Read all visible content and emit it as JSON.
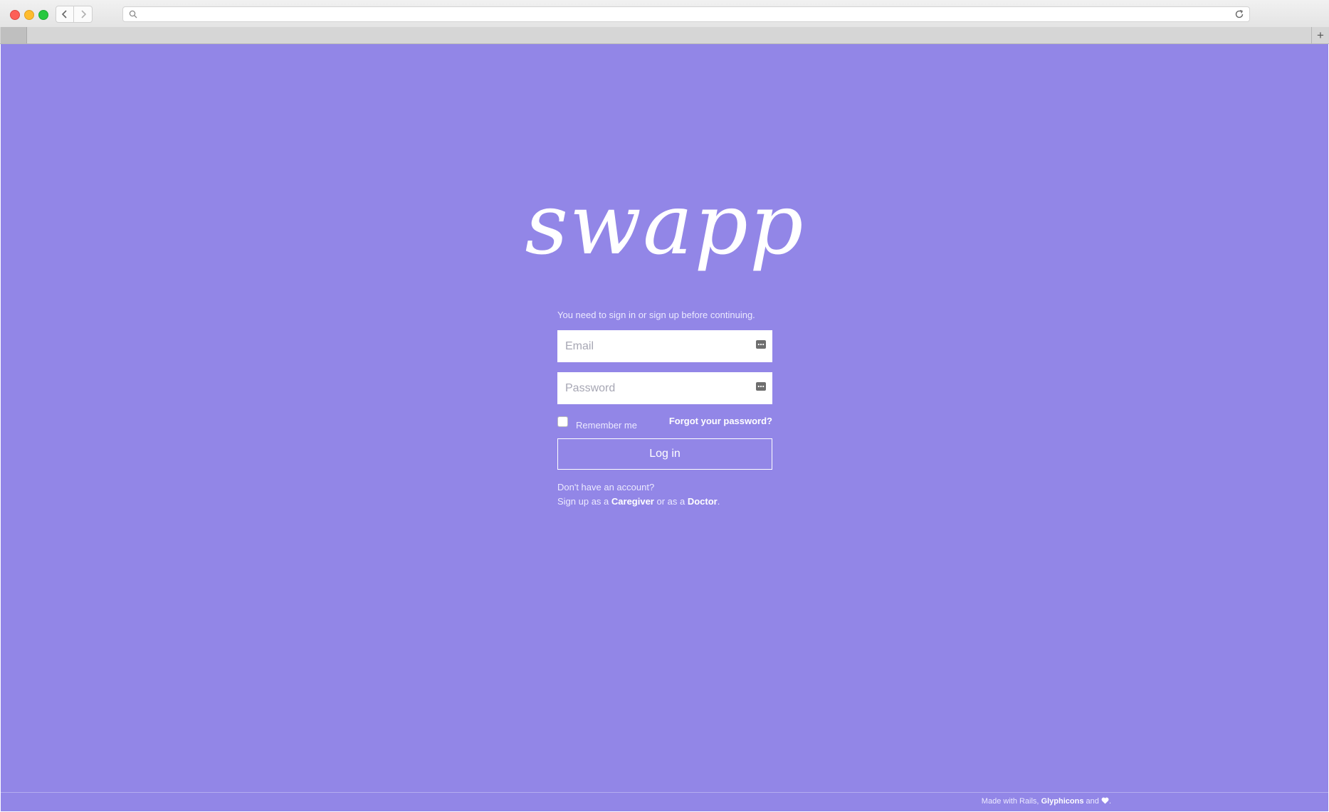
{
  "brand": {
    "logo_text": "swapp",
    "background_color": "#9286e7"
  },
  "browser": {
    "url": "",
    "new_tab_symbol": "+"
  },
  "form": {
    "notice": "You need to sign in or sign up before continuing.",
    "email_placeholder": "Email",
    "password_placeholder": "Password",
    "remember_label": "Remember me",
    "forgot_link": "Forgot your password?",
    "login_button": "Log in",
    "no_account_text": "Don't have an account?",
    "signup_prefix": "Sign up as a ",
    "caregiver_link": "Caregiver",
    "signup_middle": " or as a ",
    "doctor_link": "Doctor",
    "signup_suffix": "."
  },
  "footer": {
    "prefix": "Made with Rails, ",
    "glyphicons_link": "Glyphicons",
    "middle": " and ",
    "suffix": "."
  }
}
